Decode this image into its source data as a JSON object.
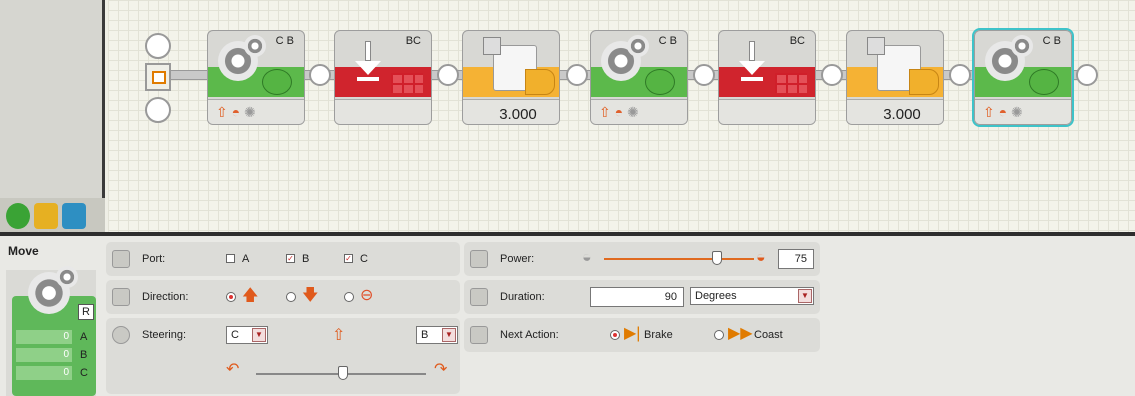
{
  "sequence": {
    "blocks": [
      {
        "kind": "move",
        "ports": "C B",
        "value": ""
      },
      {
        "kind": "stop",
        "ports": "BC",
        "value": ""
      },
      {
        "kind": "wait",
        "ports": "",
        "value": "3.000"
      },
      {
        "kind": "move",
        "ports": "C B",
        "value": ""
      },
      {
        "kind": "stop",
        "ports": "BC",
        "value": ""
      },
      {
        "kind": "wait",
        "ports": "",
        "value": "3.000"
      },
      {
        "kind": "move",
        "ports": "C B",
        "value": "",
        "selected": true
      }
    ]
  },
  "palette": {
    "tabs": [
      "common-palette-icon",
      "complete-palette-icon",
      "custom-palette-icon"
    ],
    "colors": {
      "common": "#3aa335",
      "complete": "#e6b022",
      "custom": "#2e8fc2"
    }
  },
  "panel": {
    "block_name": "Move",
    "counters": [
      {
        "value": "0",
        "label": "A"
      },
      {
        "value": "0",
        "label": "B"
      },
      {
        "value": "0",
        "label": "C"
      }
    ],
    "reset_label": "R",
    "port": {
      "label": "Port:",
      "options": [
        {
          "name": "A",
          "checked": false
        },
        {
          "name": "B",
          "checked": true
        },
        {
          "name": "C",
          "checked": true
        }
      ]
    },
    "direction": {
      "label": "Direction:",
      "options": [
        "forward",
        "backward",
        "stop"
      ],
      "selected": "forward"
    },
    "steering": {
      "label": "Steering:",
      "left_port": "C",
      "right_port": "B"
    },
    "power": {
      "label": "Power:",
      "value": "75",
      "level": 0.75
    },
    "duration": {
      "label": "Duration:",
      "value": "90",
      "unit": "Degrees"
    },
    "next_action": {
      "label": "Next Action:",
      "brake": "Brake",
      "coast": "Coast",
      "selected": "Brake"
    }
  }
}
